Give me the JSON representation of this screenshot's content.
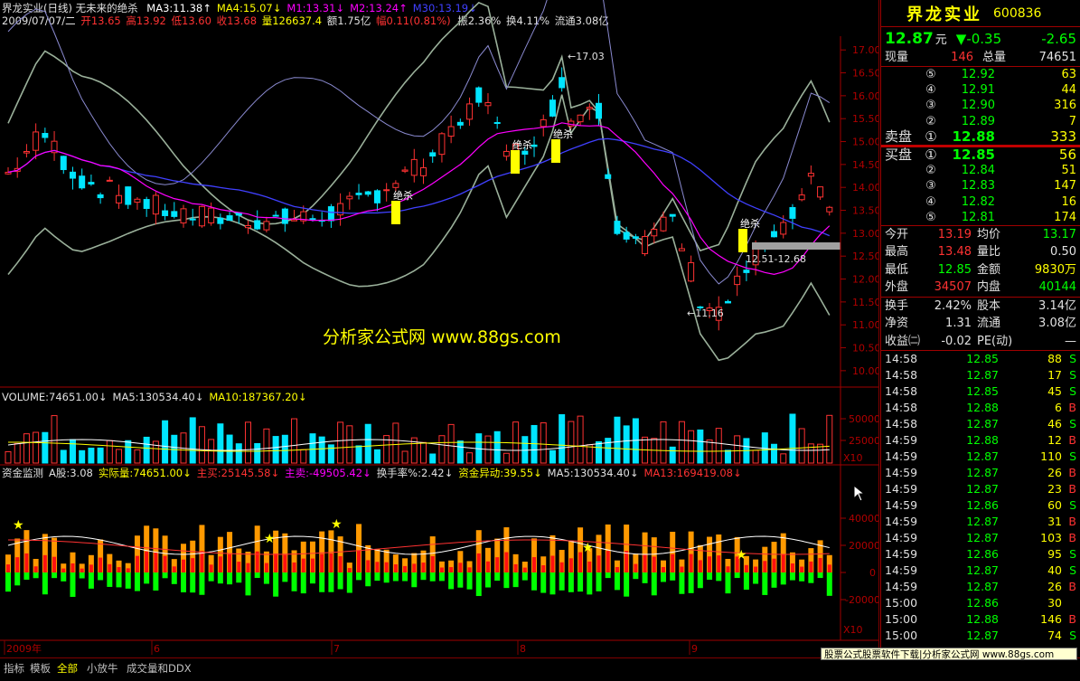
{
  "header": {
    "title": "界龙实业(日线) 无未来的绝杀",
    "ma": [
      {
        "label": "MA3:11.38",
        "arrow": "↑",
        "color": "#ffffff"
      },
      {
        "label": "MA4:15.07",
        "arrow": "↓",
        "color": "#ffff00"
      },
      {
        "label": "M1:13.31",
        "arrow": "↓",
        "color": "#ff00ff"
      },
      {
        "label": "M2:13.24",
        "arrow": "↑",
        "color": "#ff00ff"
      },
      {
        "label": "M30:13.19",
        "arrow": "↓",
        "color": "#4040ff"
      }
    ],
    "ohlc_date": "2009/07/07/二",
    "open": "开13.65",
    "high": "高13.92",
    "low": "低13.60",
    "close": "收13.68",
    "vol": "量126637.4",
    "amount": "额1.75亿",
    "change": "幅0.11(0.81%)",
    "swing": "振2.36%",
    "turnover": "换4.11%",
    "float": "流通3.08亿"
  },
  "main_chart": {
    "y_ticks": [
      "17.00",
      "16.50",
      "16.00",
      "15.50",
      "15.00",
      "14.50",
      "14.00",
      "13.50",
      "13.00",
      "12.50",
      "12.00",
      "11.50",
      "11.00",
      "10.50",
      "10.00"
    ],
    "y_min": 9.8,
    "y_max": 17.3,
    "annotation_high": "17.03",
    "annotation_low": "11.16",
    "range_label": "12.51-12.68",
    "signal_label": "绝杀",
    "watermark": "分析家公式网 www.88gs.com"
  },
  "volume": {
    "header": [
      {
        "label": "VOLUME:74651.00",
        "arrow": "↓",
        "color": "#e0e0e0"
      },
      {
        "label": "MA5:130534.40",
        "arrow": "↓",
        "color": "#e0e0e0"
      },
      {
        "label": "MA10:187367.20",
        "arrow": "↓",
        "color": "#ffff00"
      }
    ],
    "y_ticks": [
      "50000",
      "25000"
    ],
    "unit": "X10"
  },
  "fund": {
    "header": [
      {
        "label": "资金监测",
        "color": "#e0e0e0"
      },
      {
        "label": "A股:3.08",
        "color": "#e0e0e0"
      },
      {
        "label": "实际量:74651.00↓",
        "color": "#ffff00"
      },
      {
        "label": "主买:25145.58↓",
        "color": "#ff3232"
      },
      {
        "label": "主卖:-49505.42↓",
        "color": "#ff00ff"
      },
      {
        "label": "换手率%:2.42↓",
        "color": "#e0e0e0"
      },
      {
        "label": "资金异动:39.55↓",
        "color": "#ffff00"
      },
      {
        "label": "MA5:130534.40↓",
        "color": "#e0e0e0"
      },
      {
        "label": "MA13:169419.08↓",
        "color": "#ff3232"
      }
    ],
    "y_ticks": [
      "40000",
      "20000",
      "0",
      "-20000"
    ],
    "unit": "X10"
  },
  "x_axis": {
    "labels": [
      "2009年",
      "6",
      "7",
      "8",
      "9"
    ]
  },
  "bottom_tabs": [
    "指标",
    "模板",
    "全部",
    "小放牛",
    "成交量和DDX"
  ],
  "promo": "股票公式股票软件下载|分析家公式网 www.88gs.com",
  "quote": {
    "name": "界龙实业",
    "code": "600836",
    "price": "12.87",
    "price_unit": "元",
    "change": "▼-0.35",
    "change_pct": "-2.65",
    "now_vol_label": "现量",
    "now_vol": "146",
    "total_vol_label": "总量",
    "total_vol": "74651",
    "sell_label": "卖盘",
    "buy_label": "买盘",
    "asks": [
      {
        "lv": "⑤",
        "price": "12.92",
        "vol": "63"
      },
      {
        "lv": "④",
        "price": "12.91",
        "vol": "44"
      },
      {
        "lv": "③",
        "price": "12.90",
        "vol": "316"
      },
      {
        "lv": "②",
        "price": "12.89",
        "vol": "7"
      },
      {
        "lv": "①",
        "price": "12.88",
        "vol": "333"
      }
    ],
    "bids": [
      {
        "lv": "①",
        "price": "12.85",
        "vol": "56"
      },
      {
        "lv": "②",
        "price": "12.84",
        "vol": "51"
      },
      {
        "lv": "③",
        "price": "12.83",
        "vol": "147"
      },
      {
        "lv": "④",
        "price": "12.82",
        "vol": "16"
      },
      {
        "lv": "⑤",
        "price": "12.81",
        "vol": "174"
      }
    ],
    "stats": [
      {
        "k1": "今开",
        "v1": "13.19",
        "c1": "#ff3232",
        "k2": "均价",
        "v2": "13.17",
        "c2": "#00ff00"
      },
      {
        "k1": "最高",
        "v1": "13.48",
        "c1": "#ff3232",
        "k2": "量比",
        "v2": "0.50",
        "c2": "#e0e0e0"
      },
      {
        "k1": "最低",
        "v1": "12.85",
        "c1": "#00ff00",
        "k2": "金额",
        "v2": "9830万",
        "c2": "#ffff00"
      },
      {
        "k1": "外盘",
        "v1": "34507",
        "c1": "#ff3232",
        "k2": "内盘",
        "v2": "40144",
        "c2": "#00ff00"
      }
    ],
    "stats2": [
      {
        "k1": "换手",
        "v1": "2.42%",
        "c1": "#e0e0e0",
        "k2": "股本",
        "v2": "3.14亿",
        "c2": "#e0e0e0"
      },
      {
        "k1": "净资",
        "v1": "1.31",
        "c1": "#e0e0e0",
        "k2": "流通",
        "v2": "3.08亿",
        "c2": "#e0e0e0"
      },
      {
        "k1": "收益㈡",
        "v1": "-0.02",
        "c1": "#e0e0e0",
        "k2": "PE(动)",
        "v2": "—",
        "c2": "#e0e0e0"
      }
    ],
    "ticks": [
      {
        "t": "14:58",
        "p": "12.85",
        "v": "88",
        "d": "S"
      },
      {
        "t": "14:58",
        "p": "12.87",
        "v": "17",
        "d": "S"
      },
      {
        "t": "14:58",
        "p": "12.85",
        "v": "45",
        "d": "S"
      },
      {
        "t": "14:58",
        "p": "12.88",
        "v": "6",
        "d": "B"
      },
      {
        "t": "14:58",
        "p": "12.87",
        "v": "46",
        "d": "S"
      },
      {
        "t": "14:59",
        "p": "12.88",
        "v": "12",
        "d": "B"
      },
      {
        "t": "14:59",
        "p": "12.87",
        "v": "110",
        "d": "S"
      },
      {
        "t": "14:59",
        "p": "12.87",
        "v": "26",
        "d": "B"
      },
      {
        "t": "14:59",
        "p": "12.87",
        "v": "23",
        "d": "B"
      },
      {
        "t": "14:59",
        "p": "12.86",
        "v": "60",
        "d": "S"
      },
      {
        "t": "14:59",
        "p": "12.87",
        "v": "31",
        "d": "B"
      },
      {
        "t": "14:59",
        "p": "12.87",
        "v": "103",
        "d": "B"
      },
      {
        "t": "14:59",
        "p": "12.86",
        "v": "95",
        "d": "S"
      },
      {
        "t": "14:59",
        "p": "12.87",
        "v": "40",
        "d": "S"
      },
      {
        "t": "14:59",
        "p": "12.87",
        "v": "26",
        "d": "B"
      },
      {
        "t": "15:00",
        "p": "12.86",
        "v": "30",
        "d": ""
      },
      {
        "t": "15:00",
        "p": "12.88",
        "v": "146",
        "d": "B"
      },
      {
        "t": "15:00",
        "p": "12.87",
        "v": "74",
        "d": "S"
      }
    ]
  }
}
